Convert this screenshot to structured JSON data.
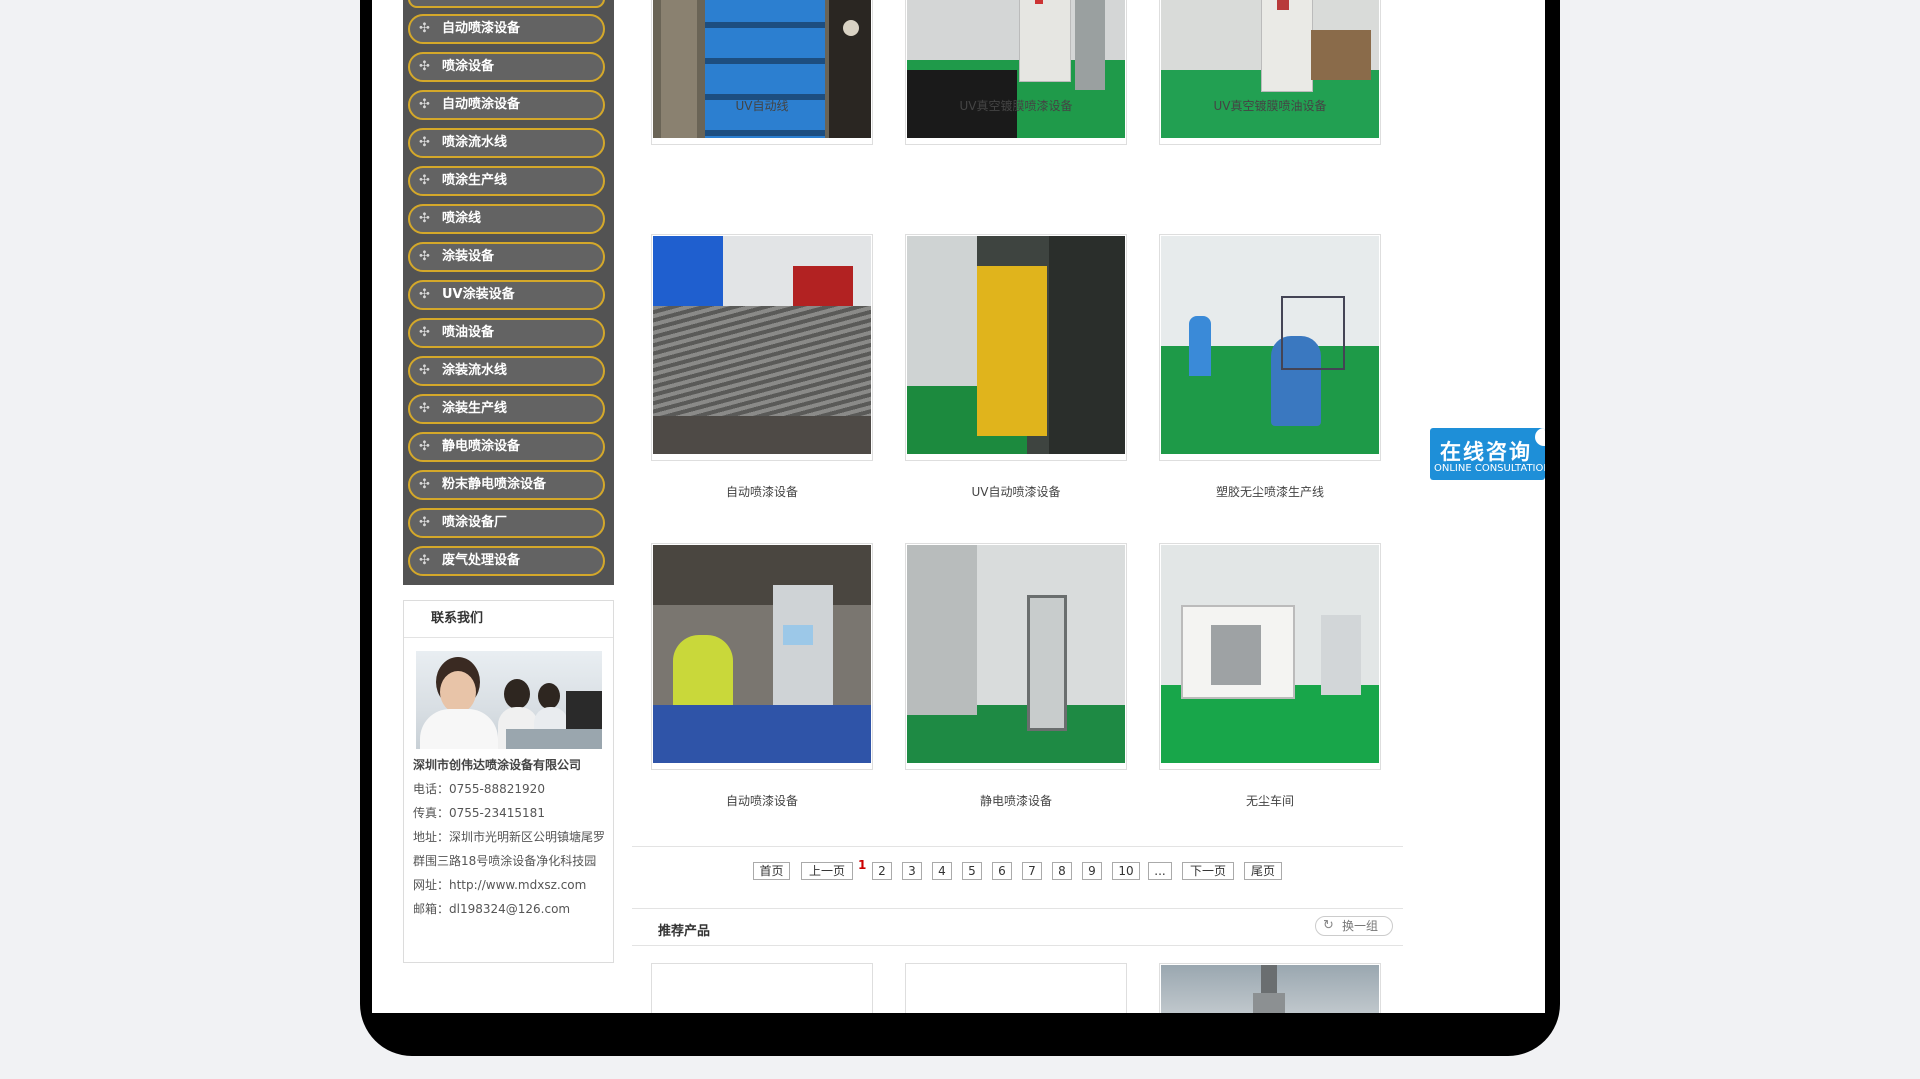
{
  "sidebar": {
    "categories": [
      "自动喷漆设备",
      "喷涂设备",
      "自动喷涂设备",
      "喷涂流水线",
      "喷涂生产线",
      "喷涂线",
      "涂装设备",
      "UV涂装设备",
      "喷油设备",
      "涂装流水线",
      "涂装生产线",
      "静电喷涂设备",
      "粉末静电喷涂设备",
      "喷涂设备厂",
      "废气处理设备"
    ],
    "contact": {
      "title": "联系我们",
      "company": "深圳市创伟达喷涂设备有限公司",
      "phone": "电话：0755-88821920",
      "fax": "传真：0755-23415181",
      "address": "地址：深圳市光明新区公明镇塘尾罗群围三路18号喷涂设备净化科技园",
      "website": "网址：http://www.mdxsz.com",
      "email": "邮箱：dl198324@126.com"
    }
  },
  "products": [
    {
      "caption": "UV自动线"
    },
    {
      "caption": "UV真空镀膜喷漆设备"
    },
    {
      "caption": "UV真空镀膜喷油设备"
    },
    {
      "caption": "自动喷漆设备"
    },
    {
      "caption": "UV自动喷漆设备"
    },
    {
      "caption": "塑胶无尘喷漆生产线"
    },
    {
      "caption": "自动喷漆设备"
    },
    {
      "caption": "静电喷漆设备"
    },
    {
      "caption": "无尘车间"
    }
  ],
  "pagination": {
    "first": "首页",
    "prev": "上一页",
    "current": "1",
    "pages": [
      "2",
      "3",
      "4",
      "5",
      "6",
      "7",
      "8",
      "9",
      "10"
    ],
    "ellipsis": "...",
    "next": "下一页",
    "last": "尾页"
  },
  "recommended": {
    "title": "推荐产品",
    "swap_label": "换一组"
  },
  "consult": {
    "cn": "在线咨询",
    "en": "ONLINE CONSULTATION"
  },
  "colors": {
    "sidebar_bg": "#535353",
    "item_border": "#d4a82a",
    "page_current": "#cc0000",
    "consult_bg": "#1e8fd8"
  }
}
